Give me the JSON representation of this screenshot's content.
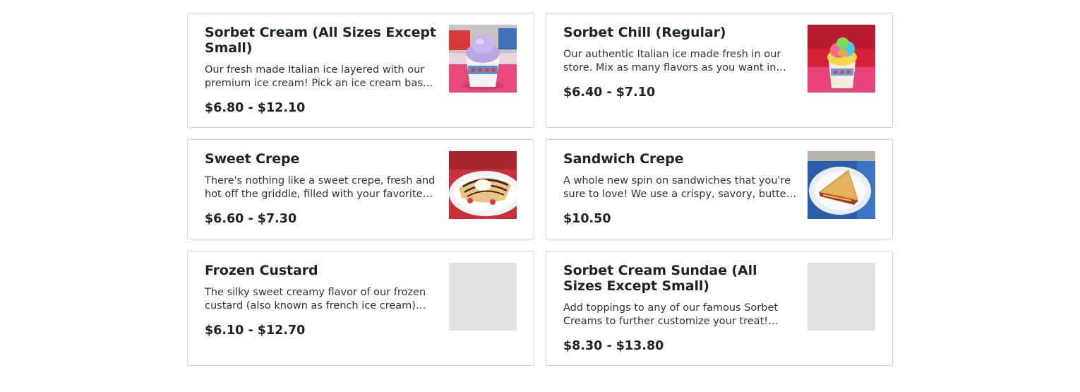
{
  "menu_items": [
    {
      "name": "Sorbet Cream (All Sizes Except Small)",
      "description": "Our fresh made Italian ice layered with our premium ice cream! Pick an ice cream base then mix as many flavors as you want.",
      "price": "$6.80 - $12.10",
      "image": "sorbet-cream-photo"
    },
    {
      "name": "Sorbet Chill (Regular)",
      "description": "Our authentic Italian ice made fresh in our store. Mix as many flavors as you want in each scoop to create your own.",
      "price": "$6.40 - $7.10",
      "image": "sorbet-chill-photo"
    },
    {
      "name": "Sweet Crepe",
      "description": "There's nothing like a sweet crepe, fresh and hot off the griddle, filled with your favorite fruits, nuts and toppings.",
      "price": "$6.60 - $7.30",
      "image": "sweet-crepe-photo"
    },
    {
      "name": "Sandwich Crepe",
      "description": "A whole new spin on sandwiches that you're sure to love! We use a crispy, savory, buttery crepe to wrap your fillings.",
      "price": "$10.50",
      "image": "sandwich-crepe-photo"
    },
    {
      "name": "Frozen Custard",
      "description": "The silky sweet creamy flavor of our frozen custard (also known as french ice cream) comes from real eggs.",
      "price": "$6.10 - $12.70",
      "image": "placeholder"
    },
    {
      "name": "Sorbet Cream Sundae (All Sizes Except Small)",
      "description": "Add toppings to any of our famous Sorbet Creams to further customize your treat! Choose from our many toppings.",
      "price": "$8.30 - $13.80",
      "image": "placeholder"
    }
  ],
  "colors": {
    "card_border": "#d6d6d6",
    "text": "#1f2329",
    "placeholder": "#e2e2e2"
  }
}
